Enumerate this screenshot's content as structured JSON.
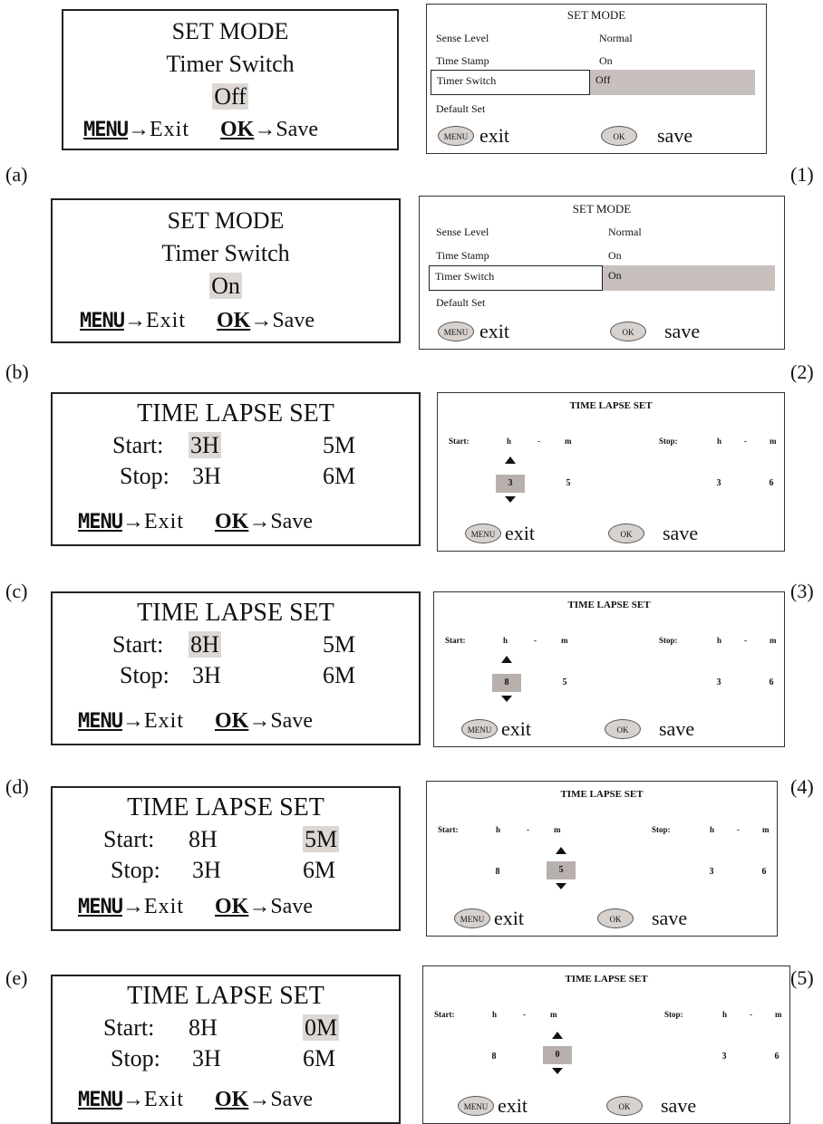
{
  "common": {
    "menu_key": "MENU",
    "ok_key": "OK",
    "arrow": "→",
    "exit": "Exit",
    "save": "Save",
    "menu_btn": "MENU",
    "ok_btn": "OK",
    "exit_lc": "exit",
    "save_lc": "save"
  },
  "set_mode": {
    "title": "SET MODE",
    "label": "Timer Switch",
    "sense_level": "Sense Level",
    "sense_value": "Normal",
    "time_stamp": "Time Stamp",
    "time_stamp_value": "On",
    "timer_switch": "Timer Switch",
    "default_set": "Default Set"
  },
  "panels": [
    {
      "left_caption": "(a)",
      "right_caption": "(1)",
      "value": "Off"
    },
    {
      "left_caption": "(b)",
      "right_caption": "(2)",
      "value": "On"
    }
  ],
  "time_lapse": {
    "title": "TIME LAPSE SET",
    "start_label": "Start:",
    "stop_label": "Stop:",
    "h": "h",
    "dash": "-",
    "m": "m",
    "stop_lab_short": "Stop:",
    "items": [
      {
        "left_caption": "(c)",
        "right_caption": "(3)",
        "start_h": "3H",
        "start_m": "5M",
        "stop_h": "3H",
        "stop_m": "6M",
        "sh": "3",
        "sm": "5",
        "eh": "3",
        "em": "6"
      },
      {
        "left_caption": "(d)",
        "right_caption": "(4)",
        "start_h": "8H",
        "start_m": "5M",
        "stop_h": "3H",
        "stop_m": "6M",
        "sh": "8",
        "sm": "5",
        "eh": "3",
        "em": "6"
      },
      {
        "left_caption": "(e)",
        "right_caption": "(5)",
        "start_h": "8H",
        "start_m": "5M",
        "stop_h": "3H",
        "stop_m": "6M",
        "sh": "8",
        "sm": "5",
        "eh": "3",
        "em": "6"
      },
      {
        "left_caption": "",
        "right_caption": "",
        "start_h": "8H",
        "start_m": "0M",
        "stop_h": "3H",
        "stop_m": "6M",
        "sh": "8",
        "sm": "0",
        "eh": "3",
        "em": "6"
      }
    ]
  }
}
